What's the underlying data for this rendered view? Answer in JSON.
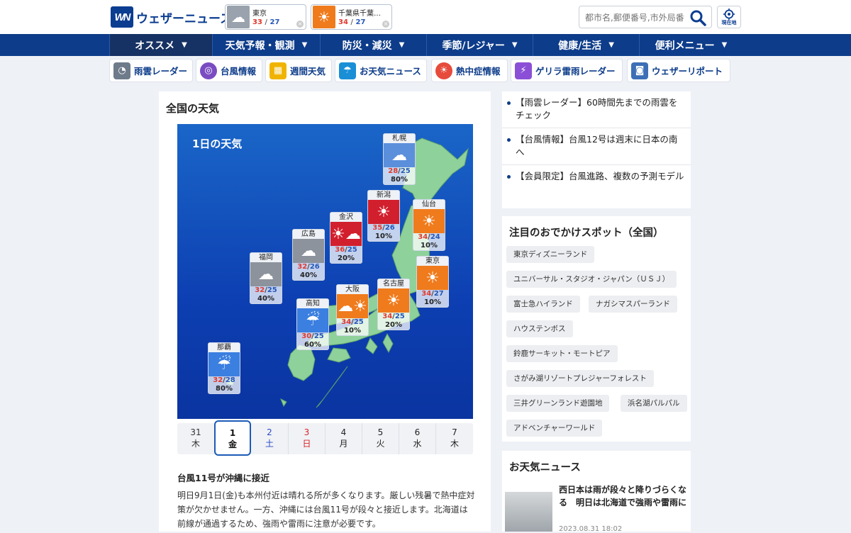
{
  "header": {
    "logo_mark": "WN",
    "logo_text": "ウェザーニュース",
    "cards": [
      {
        "name": "東京",
        "high": "33",
        "low": "27",
        "icon": "cloudy-sun-icon"
      },
      {
        "name": "千葉県千葉…",
        "high": "34",
        "low": "27",
        "icon": "sun-icon"
      }
    ],
    "temp_sep": "/",
    "search_placeholder": "都市名,郵便番号,市外局番",
    "location_label": "現在地"
  },
  "nav": [
    "オススメ",
    "天気予報・観測",
    "防災・減災",
    "季節/レジャー",
    "健康/生活",
    "便利メニュー"
  ],
  "tools": [
    {
      "label": "雨雲レーダー",
      "icon": "rain-radar-icon",
      "color": "#6e7b8a"
    },
    {
      "label": "台風情報",
      "icon": "typhoon-icon",
      "color": "#7a4cc2"
    },
    {
      "label": "週間天気",
      "icon": "calendar-icon",
      "color": "#f0b400"
    },
    {
      "label": "お天気ニュース",
      "icon": "news-icon",
      "color": "#1a8fd6"
    },
    {
      "label": "熱中症情報",
      "icon": "heatstroke-icon",
      "color": "#e64b3c"
    },
    {
      "label": "ゲリラ雷雨レーダー",
      "icon": "thunder-icon",
      "color": "#8a4fd6"
    },
    {
      "label": "ウェザーリポート",
      "icon": "camera-icon",
      "color": "#3d6fb6"
    }
  ],
  "main": {
    "title": "全国の天気",
    "map_title": "1日の天気",
    "cities": [
      {
        "name": "札幌",
        "high": "28",
        "low": "25",
        "pop": "80%",
        "color": "#5b8fdc",
        "icon": "snow-cloud-icon"
      },
      {
        "name": "新潟",
        "high": "35",
        "low": "26",
        "pop": "10%",
        "color": "#d21f2d",
        "icon": "sun-icon"
      },
      {
        "name": "金沢",
        "high": "36",
        "low": "25",
        "pop": "20%",
        "color": "#d21f2d",
        "icon": "sun-cloud-icon"
      },
      {
        "name": "仙台",
        "high": "34",
        "low": "24",
        "pop": "10%",
        "color": "#f07b1c",
        "icon": "sun-icon"
      },
      {
        "name": "広島",
        "high": "32",
        "low": "26",
        "pop": "40%",
        "color": "#8c939c",
        "icon": "cloud-icon"
      },
      {
        "name": "福岡",
        "high": "32",
        "low": "25",
        "pop": "40%",
        "color": "#8c939c",
        "icon": "cloud-icon"
      },
      {
        "name": "東京",
        "high": "34",
        "low": "27",
        "pop": "10%",
        "color": "#f07b1c",
        "icon": "sun-icon"
      },
      {
        "name": "大阪",
        "high": "34",
        "low": "25",
        "pop": "10%",
        "color": "#f07b1c",
        "icon": "cloud-sun-icon"
      },
      {
        "name": "名古屋",
        "high": "34",
        "low": "25",
        "pop": "20%",
        "color": "#f07b1c",
        "icon": "sun-icon"
      },
      {
        "name": "高知",
        "high": "30",
        "low": "25",
        "pop": "60%",
        "color": "#3b7fe0",
        "icon": "rain-cloud-icon"
      },
      {
        "name": "那覇",
        "high": "32",
        "low": "28",
        "pop": "80%",
        "color": "#3b7fe0",
        "icon": "rain-cloud-icon"
      }
    ],
    "days": [
      {
        "d": "31",
        "w": "木",
        "color": "#333"
      },
      {
        "d": "1",
        "w": "金",
        "color": "#111"
      },
      {
        "d": "2",
        "w": "土",
        "color": "#2a48c8"
      },
      {
        "d": "3",
        "w": "日",
        "color": "#d8242b"
      },
      {
        "d": "4",
        "w": "月",
        "color": "#333"
      },
      {
        "d": "5",
        "w": "火",
        "color": "#333"
      },
      {
        "d": "6",
        "w": "水",
        "color": "#333"
      },
      {
        "d": "7",
        "w": "木",
        "color": "#333"
      }
    ],
    "forecast_title": "台風11号が沖縄に接近",
    "forecast_body": "明日9月1日(金)も本州付近は晴れる所が多くなります。厳しい残暑で熱中症対策が欠かせません。一方、沖縄には台風11号が段々と接近します。北海道は前線が通過するため、強雨や雷雨に注意が必要です。"
  },
  "side": {
    "news": [
      "【雨雲レーダー】60時間先までの雨雲をチェック",
      "【台風情報】台風12号は週末に日本の南へ",
      "【会員限定】台風進路、複数の予測モデル"
    ],
    "spots_title": "注目のおでかけスポット（全国）",
    "spots": [
      "東京ディズニーランド",
      "ユニバーサル・スタジオ・ジャパン（ＵＳＪ）",
      "富士急ハイランド",
      "ナガシマスパーランド",
      "ハウステンボス",
      "鈴鹿サーキット・モートピア",
      "さがみ湖リゾートプレジャーフォレスト",
      "三井グリーンランド遊園地",
      "浜名湖パルパル",
      "アドベンチャーワールド"
    ],
    "wnews_title": "お天気ニュース",
    "wnews_item_title": "西日本は雨が段々と降りづらくなる　明日は北海道で強雨や雷雨に",
    "wnews_item_date": "2023.08.31 18:02"
  }
}
